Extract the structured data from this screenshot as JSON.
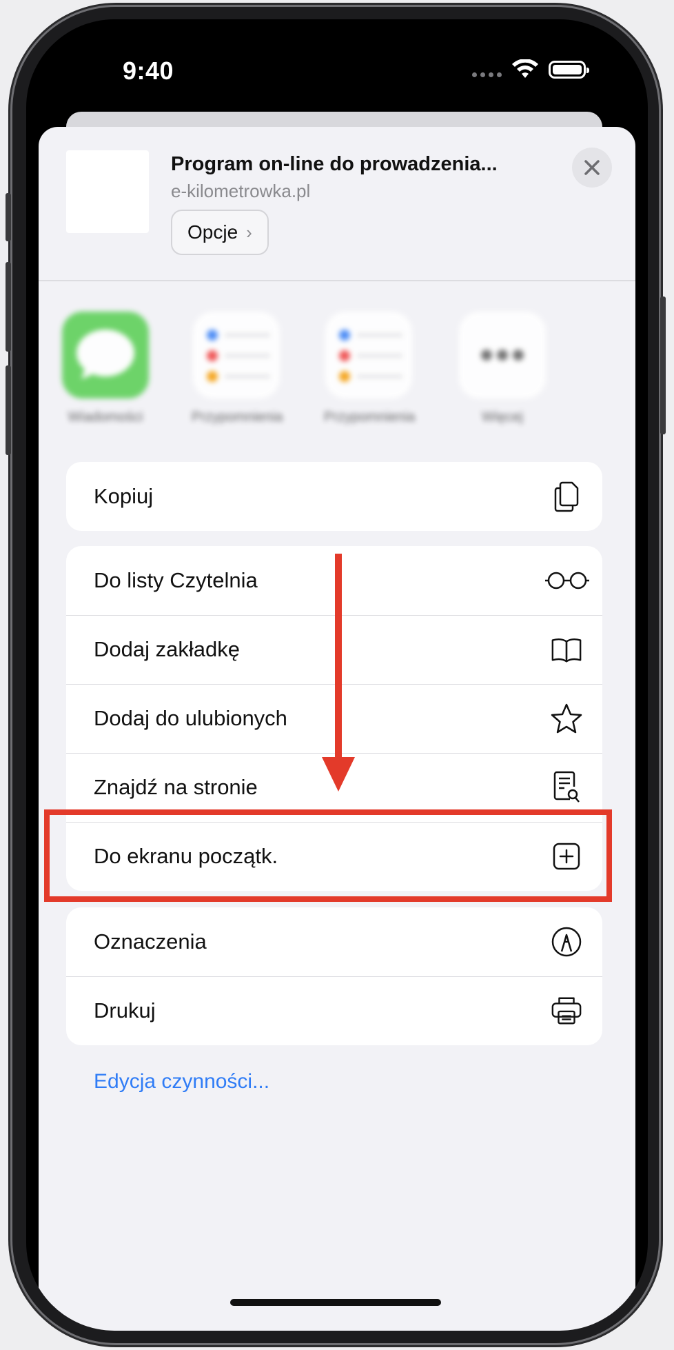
{
  "status_bar": {
    "time": "9:40"
  },
  "share_sheet": {
    "page_title": "Program on-line do prowadzenia...",
    "page_url": "e-kilometrowka.pl",
    "options_label": "Opcje",
    "apps": [
      {
        "label": "Wiadomości",
        "icon": "messages-icon"
      },
      {
        "label": "Przypomnienia",
        "icon": "reminders-icon"
      },
      {
        "label": "Przypomnienia",
        "icon": "reminders-icon"
      },
      {
        "label": "Więcej",
        "icon": "more-icon"
      }
    ],
    "group1": [
      {
        "label": "Kopiuj",
        "icon": "copy-icon"
      }
    ],
    "group2": [
      {
        "label": "Do listy Czytelnia",
        "icon": "glasses-icon"
      },
      {
        "label": "Dodaj zakładkę",
        "icon": "book-icon"
      },
      {
        "label": "Dodaj do ulubionych",
        "icon": "star-icon"
      },
      {
        "label": "Znajdź na stronie",
        "icon": "find-in-page-icon"
      },
      {
        "label": "Do ekranu początk.",
        "icon": "add-square-icon"
      }
    ],
    "group3": [
      {
        "label": "Oznaczenia",
        "icon": "markup-icon"
      },
      {
        "label": "Drukuj",
        "icon": "printer-icon"
      }
    ],
    "edit_actions": "Edycja czynności..."
  },
  "colors": {
    "annotation": "#e33a2a",
    "link": "#2f7cf6",
    "messages_green": "#5fd05a"
  }
}
